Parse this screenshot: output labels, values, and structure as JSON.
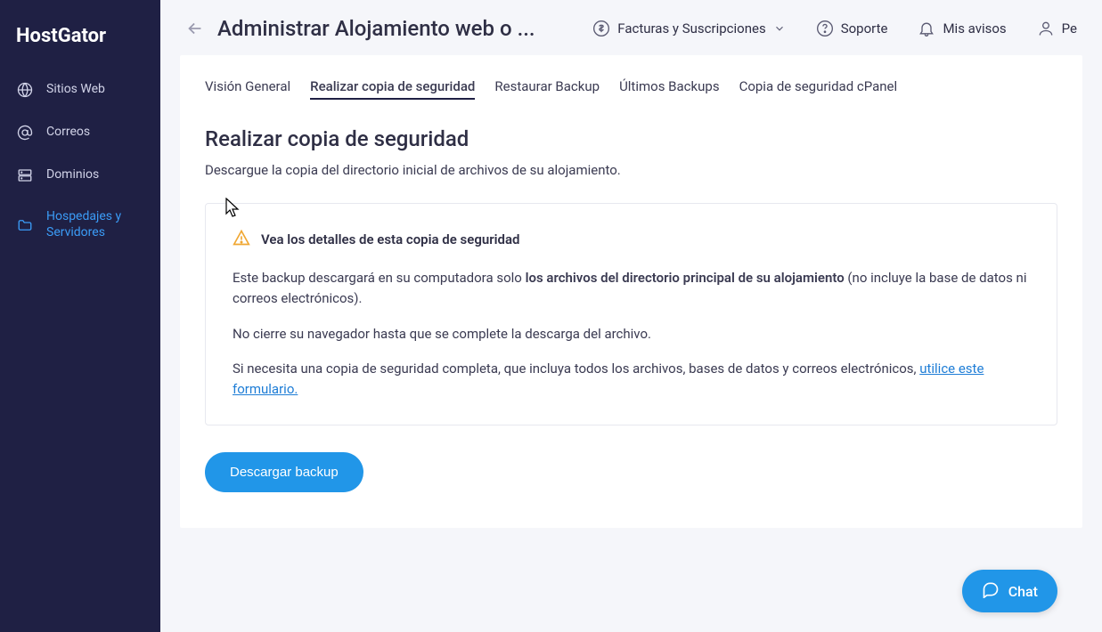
{
  "brand": "HostGator",
  "sidebar": {
    "items": [
      {
        "label": "Sitios Web",
        "icon": "globe-icon"
      },
      {
        "label": "Correos",
        "icon": "at-icon"
      },
      {
        "label": "Dominios",
        "icon": "server-icon"
      },
      {
        "label": "Hospedajes y Servidores",
        "icon": "folder-icon"
      }
    ]
  },
  "header": {
    "title": "Administrar Alojamiento web o ...",
    "links": {
      "billing": "Facturas y Suscripciones",
      "support": "Soporte",
      "notices": "Mis avisos",
      "profile": "Pe"
    }
  },
  "tabs": [
    "Visión General",
    "Realizar copia de seguridad",
    "Restaurar Backup",
    "Últimos Backups",
    "Copia de seguridad cPanel"
  ],
  "section": {
    "title": "Realizar copia de seguridad",
    "desc": "Descargue la copia del directorio inicial de archivos de su alojamiento."
  },
  "info": {
    "title": "Vea los detalles de esta copia de seguridad",
    "p1_pre": "Este backup descargará en su computadora solo ",
    "p1_bold": "los archivos del directorio principal de su alojamiento",
    "p1_post": " (no incluye la base de datos ni correos electrónicos).",
    "p2": "No cierre su navegador hasta que se complete la descarga del archivo.",
    "p3_pre": "Si necesita una copia de seguridad completa, que incluya todos los archivos, bases de datos y correos electrónicos, ",
    "p3_link": "utilice este formulario."
  },
  "download_btn": "Descargar backup",
  "chat": "Chat"
}
